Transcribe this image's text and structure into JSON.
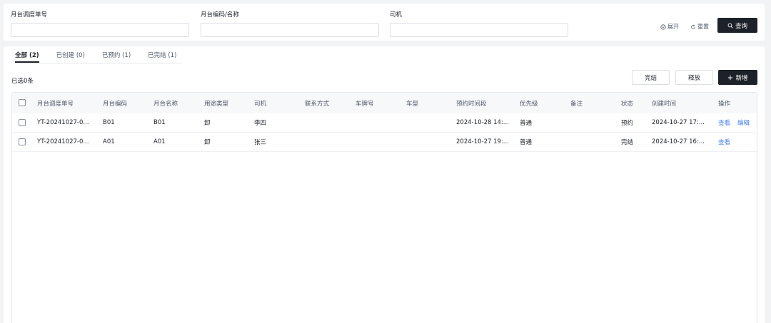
{
  "filters": {
    "dispatch_no_label": "月台调度单号",
    "dock_code_label": "月台编码/名称",
    "driver_label": "司机",
    "expand_label": "展开",
    "reset_label": "重置",
    "query_label": "查询"
  },
  "tabs": [
    {
      "label": "全部 (2)"
    },
    {
      "label": "已创建 (0)"
    },
    {
      "label": "已预约 (1)"
    },
    {
      "label": "已完结 (1)"
    }
  ],
  "toolbar": {
    "selected_text": "已选0条",
    "complete_label": "完结",
    "release_label": "释放",
    "add_label": "新增"
  },
  "table": {
    "columns": [
      "月台调度单号",
      "月台编码",
      "月台名称",
      "用途类型",
      "司机",
      "联系方式",
      "车牌号",
      "车型",
      "预约时间段",
      "优先级",
      "备注",
      "状态",
      "创建时间",
      "操作"
    ],
    "rows": [
      {
        "cells": [
          "YT-20241027-0...",
          "B01",
          "B01",
          "卸",
          "李四",
          "",
          "",
          "",
          "2024-10-28 14:...",
          "普通",
          "",
          "预约",
          "2024-10-27 17:..."
        ],
        "actions": [
          "查看",
          "编辑"
        ]
      },
      {
        "cells": [
          "YT-20241027-0...",
          "A01",
          "A01",
          "卸",
          "张三",
          "",
          "",
          "",
          "2024-10-27 19:...",
          "普通",
          "",
          "完结",
          "2024-10-27 16:..."
        ],
        "actions": [
          "查看"
        ]
      }
    ]
  },
  "colors": {
    "primary_dark": "#1d2129",
    "link": "#4080ff",
    "page_bg": "#f2f3f5"
  }
}
